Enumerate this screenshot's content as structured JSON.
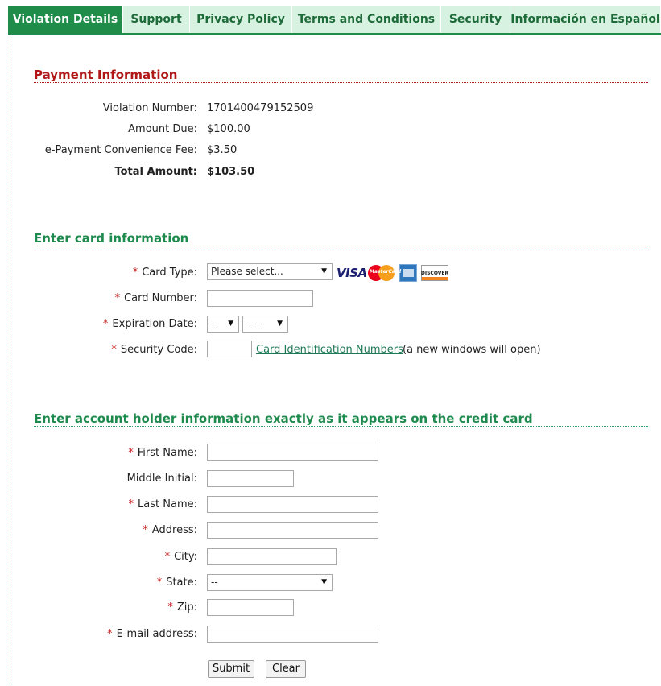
{
  "tabs": [
    {
      "label": "Violation Details",
      "active": true
    },
    {
      "label": "Support"
    },
    {
      "label": "Privacy Policy"
    },
    {
      "label": "Terms and Conditions"
    },
    {
      "label": "Security"
    },
    {
      "label": "Información en Español"
    }
  ],
  "payment": {
    "title": "Payment Information",
    "rows": [
      {
        "label": "Violation Number:",
        "value": "1701400479152509"
      },
      {
        "label": "Amount Due:",
        "value": "$100.00"
      },
      {
        "label": "e-Payment Convenience Fee:",
        "value": "$3.50"
      },
      {
        "label": "Total Amount:",
        "value": "$103.50"
      }
    ]
  },
  "card": {
    "title": "Enter card information",
    "required_mark": "*",
    "card_type_label": "Card Type:",
    "card_type_value": "Please select...",
    "card_logos": [
      "VISA",
      "MasterCard",
      "American Express",
      "DISCOVER"
    ],
    "card_number_label": "Card Number:",
    "expiration_label": "Expiration Date:",
    "exp_month_value": "--",
    "exp_year_value": "----",
    "security_code_label": "Security Code:",
    "cin_link": "Card Identification Numbers",
    "cin_note": "(a new windows will open)"
  },
  "holder": {
    "title": "Enter account holder information exactly as it appears on the credit card",
    "first_name_label": "First Name:",
    "middle_initial_label": "Middle Initial:",
    "last_name_label": "Last Name:",
    "address_label": "Address:",
    "city_label": "City:",
    "state_label": "State:",
    "state_value": "--",
    "zip_label": "Zip:",
    "email_label": "E-mail address:"
  },
  "buttons": {
    "submit": "Submit",
    "clear": "Clear"
  },
  "colors": {
    "tab_active": "#1f8c49",
    "tab_bg": "#d7f2e0",
    "section_red": "#b01717",
    "section_green": "#1e8a4e",
    "required": "#c81c1c"
  }
}
